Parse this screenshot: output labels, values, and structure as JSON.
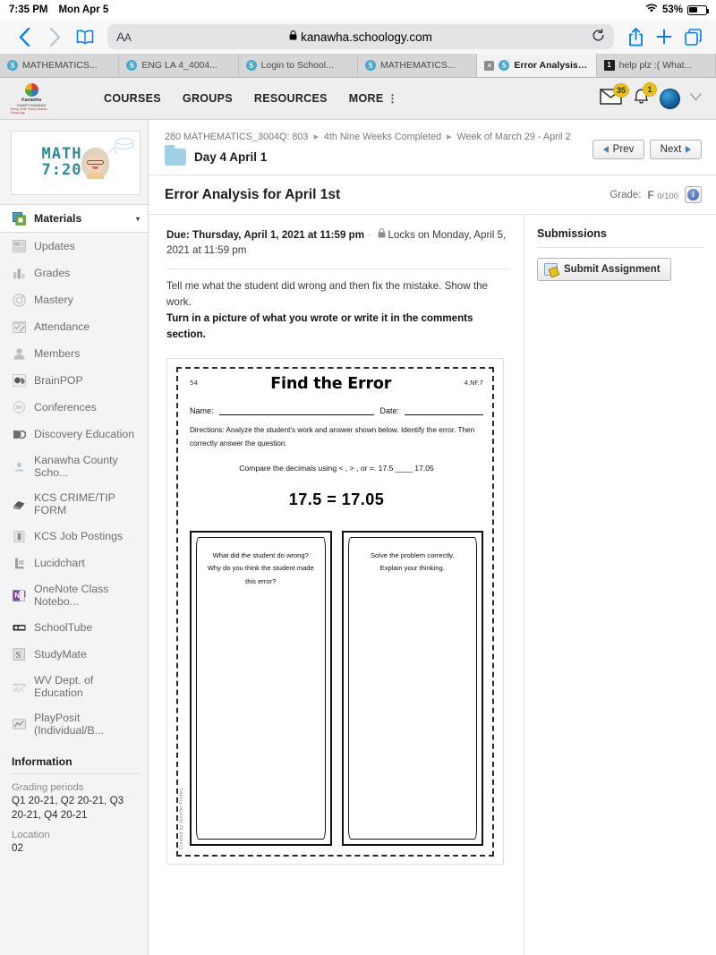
{
  "status_bar": {
    "time": "7:35 PM",
    "date": "Mon Apr 5",
    "battery_percent": "53%",
    "wifi_icon": "wifi-icon",
    "battery_icon": "battery-icon"
  },
  "browser": {
    "back_icon": "back-chevron-icon",
    "forward_icon": "forward-chevron-icon",
    "bookmarks_icon": "book-icon",
    "text_size_label": "AA",
    "lock_icon": "lock-icon",
    "url": "kanawha.schoology.com",
    "reload_icon": "reload-icon",
    "share_icon": "share-icon",
    "new_tab_icon": "plus-icon",
    "tabs_overview_icon": "tabs-icon",
    "tabs": [
      {
        "label": "MATHEMATICS...",
        "favicon": "schoology-favicon",
        "active": false
      },
      {
        "label": "ENG LA 4_4004...",
        "favicon": "schoology-favicon",
        "active": false
      },
      {
        "label": "Login to School...",
        "favicon": "schoology-favicon",
        "active": false
      },
      {
        "label": "MATHEMATICS...",
        "favicon": "schoology-favicon",
        "active": false
      },
      {
        "label": "Error Analysis f...",
        "favicon": "schoology-favicon",
        "active": true,
        "close_label": "×"
      },
      {
        "label": "help plz :( What...",
        "favicon": "dark-favicon",
        "active": false
      }
    ]
  },
  "top_nav": {
    "logo_name": "Kanawha",
    "logo_sub": "COUNTY SCHOOLS",
    "logo_tagline": "Every Child. Every Chance. Every Day.",
    "links": [
      {
        "label": "COURSES"
      },
      {
        "label": "GROUPS"
      },
      {
        "label": "RESOURCES"
      },
      {
        "label": "MORE"
      }
    ],
    "kebab": "⋮",
    "messages_icon": "envelope-icon",
    "messages_badge": "35",
    "notifications_icon": "bell-icon",
    "notifications_badge": "1",
    "avatar_icon": "user-avatar",
    "account_chevron": "chevron-down-icon",
    "badge_color": "#e8c11c"
  },
  "sidebar": {
    "course_banner": {
      "line1": "MATH",
      "line2": "7:20",
      "accent_color": "#2f8a96"
    },
    "items": [
      {
        "label": "Materials",
        "icon": "materials-icon",
        "active": true,
        "caret": "▾",
        "color": "#3b86c4"
      },
      {
        "label": "Updates",
        "icon": "updates-icon",
        "active": false,
        "color": "#c9c9c9"
      },
      {
        "label": "Grades",
        "icon": "grades-icon",
        "active": false,
        "color": "#c9c9c9"
      },
      {
        "label": "Mastery",
        "icon": "mastery-icon",
        "active": false,
        "color": "#c9c9c9"
      },
      {
        "label": "Attendance",
        "icon": "attendance-icon",
        "active": false,
        "color": "#c9c9c9"
      },
      {
        "label": "Members",
        "icon": "members-icon",
        "active": false,
        "color": "#c9c9c9"
      },
      {
        "label": "BrainPOP",
        "icon": "brainpop-icon",
        "active": false,
        "color": "#8d8d8d"
      },
      {
        "label": "Conferences",
        "icon": "conferences-icon",
        "active": false,
        "color": "#d2d2d2"
      },
      {
        "label": "Discovery Education",
        "icon": "discovery-education-icon",
        "active": false,
        "color": "#8d8d8d"
      },
      {
        "label": "Kanawha County Scho...",
        "icon": "kanawha-county-schools-icon",
        "active": false,
        "color": "#b7b7b7"
      },
      {
        "label": "KCS CRIME/TIP FORM",
        "icon": "kcs-crime-tip-form-icon",
        "active": false,
        "color": "#6f6f6f"
      },
      {
        "label": "KCS Job Postings",
        "icon": "kcs-job-postings-icon",
        "active": false,
        "color": "#9a9a9a"
      },
      {
        "label": "Lucidchart",
        "icon": "lucidchart-icon",
        "active": false,
        "color": "#9a9a9a"
      },
      {
        "label": "OneNote Class Notebo...",
        "icon": "onenote-icon",
        "active": false,
        "color": "#7c4b9c"
      },
      {
        "label": "SchoolTube",
        "icon": "schooltube-icon",
        "active": false,
        "color": "#4a4a4a"
      },
      {
        "label": "StudyMate",
        "icon": "studymate-icon",
        "active": false,
        "color": "#7a7a7a"
      },
      {
        "label": "WV Dept. of Education",
        "icon": "wv-dept-education-icon",
        "active": false,
        "color": "#a3a3a3"
      },
      {
        "label": "PlayPosit (Individual/B...",
        "icon": "playposit-icon",
        "active": false,
        "color": "#9a9a9a"
      }
    ],
    "information": {
      "heading": "Information",
      "grading_periods_label": "Grading periods",
      "grading_periods_value": "Q1 20-21, Q2 20-21, Q3 20-21, Q4 20-21",
      "location_label": "Location",
      "location_value": "02"
    }
  },
  "main": {
    "breadcrumb": {
      "part1": "280 MATHEMATICS_3004Q: 803",
      "part2": "4th Nine Weeks Completed",
      "part3": "Week of March 29 - April 2",
      "separator": "▸"
    },
    "folder_icon": "folder-icon",
    "folder_title": "Day 4 April 1",
    "prev_label": "Prev",
    "next_label": "Next",
    "page_title": "Error Analysis for April 1st",
    "grade_label": "Grade:",
    "grade_letter": "F",
    "grade_score": "0/100",
    "grade_info_icon": "info-icon",
    "due_prefix": "Due: Thursday, April 1, 2021 at 11:59 pm",
    "due_separator": "·",
    "lock_icon": "lock-icon",
    "lock_text": "Locks on Monday, April 5, 2021 at 11:59 pm",
    "description_line1": "Tell me what the student did wrong and then fix the mistake. Show the work.",
    "description_line2": "Turn in a picture of what you wrote or write it in the comments section."
  },
  "worksheet": {
    "page_code": "54",
    "standard_code": "4.NF.7",
    "title": "Find the Error",
    "name_label": "Name:",
    "date_label": "Date:",
    "directions": "Directions: Analyze the student's work and answer shown below. Identify the error. Then correctly answer the question.",
    "problem": "Compare the decimals using < , > , or =. 17.5 ____ 17.05",
    "student_answer": "17.5 = 17.05",
    "box1_prompt": "What did the student do wrong? Why do you think the student made this error?",
    "box2_prompt": "Solve the problem correctly. Explain your thinking.",
    "credit": "Created by Jennifer Findley"
  },
  "submissions": {
    "heading": "Submissions",
    "submit_button_label": "Submit Assignment",
    "submit_icon": "submit-assignment-icon"
  }
}
